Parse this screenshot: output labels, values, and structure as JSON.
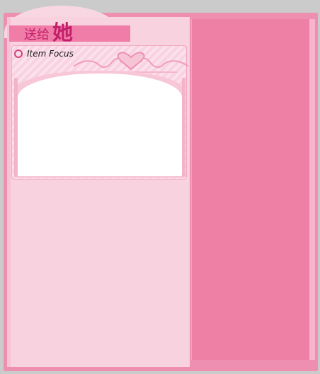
{
  "header": {
    "title_prefix": "送给",
    "title_main": "她"
  },
  "item_focus": {
    "label": "Item Focus",
    "bullet_icon": "circle-bullet-icon",
    "ornament_icon": "heart-scroll-ornament-icon"
  },
  "colors": {
    "frame": "#ee8fb2",
    "left_panel": "#f8d2de",
    "right_panel": "#ef80a5",
    "title_bar": "#ef7da7",
    "title_text": "#c41f6b"
  }
}
